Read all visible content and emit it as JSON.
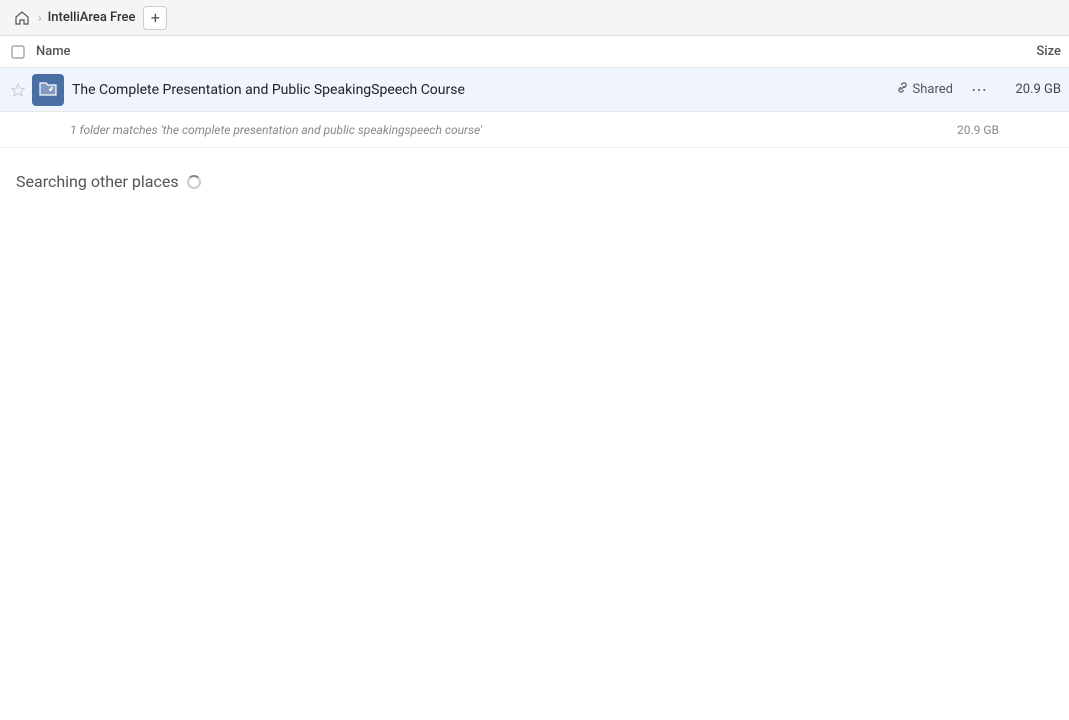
{
  "topBar": {
    "homeIcon": "⌂",
    "separator": "›",
    "title": "IntelliArea Free",
    "addIcon": "+"
  },
  "columns": {
    "nameLabel": "Name",
    "sizeLabel": "Size"
  },
  "fileRow": {
    "name": "The Complete Presentation and Public SpeakingSpeech Course",
    "sharedLabel": "Shared",
    "size": "20.9 GB",
    "moreIcon": "⋯"
  },
  "matchRow": {
    "text": "1 folder matches 'the complete presentation and public speakingspeech course'",
    "size": "20.9 GB"
  },
  "searchingRow": {
    "text": "Searching other places"
  }
}
